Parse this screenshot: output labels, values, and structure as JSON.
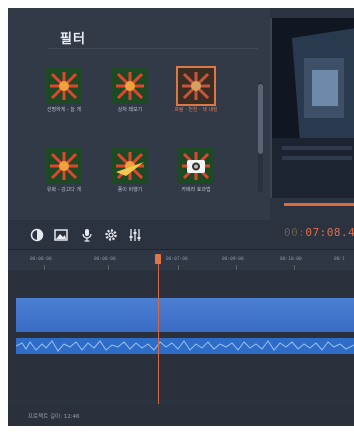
{
  "filters_panel": {
    "title": "필터",
    "items": [
      {
        "label": "선명하게 - 늘 게",
        "selected": false
      },
      {
        "label": "상처 돼보기",
        "selected": false
      },
      {
        "label": "흐림 · 천천 · 색 내린",
        "selected": true
      },
      {
        "label": "유화 - 강고다 게",
        "selected": false
      },
      {
        "label": "종이 비행기",
        "selected": false
      },
      {
        "label": "카메라 효과법",
        "selected": false
      }
    ]
  },
  "toolbar": {
    "icons": [
      "contrast-icon",
      "image-icon",
      "microphone-icon",
      "gear-icon",
      "equalizer-icon"
    ],
    "timecode_dim": "00:",
    "timecode_hi": "07:08.4"
  },
  "timeline": {
    "ruler_labels": [
      "00:00:00",
      "00:00:00",
      "00:07:00",
      "00:09:00",
      "00:10:00",
      "00:1"
    ]
  },
  "status": {
    "project_length": "프로젝트 길이: 12:46"
  },
  "colors": {
    "accent": "#e36d46",
    "clip": "#3f72c8",
    "background": "#2b3341"
  }
}
